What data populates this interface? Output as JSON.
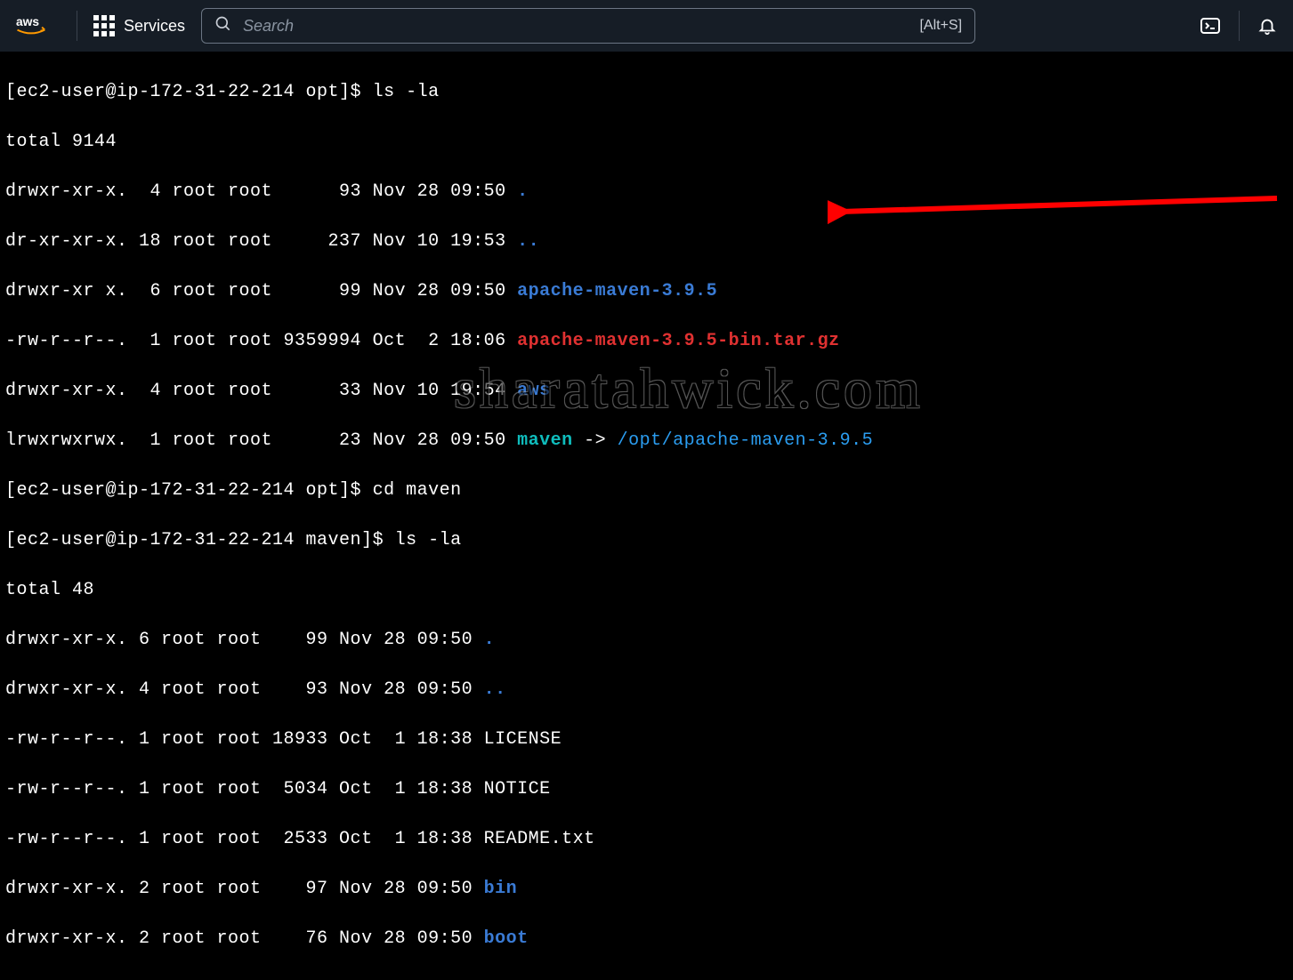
{
  "header": {
    "services_label": "Services",
    "search_placeholder": "Search",
    "search_hint": "[Alt+S]"
  },
  "watermark": "sharatahwick.com",
  "prompts": {
    "p1": "[ec2-user@ip-172-31-22-214 opt]$ ",
    "p2": "[ec2-user@ip-172-31-22-214 opt]$ ",
    "p3": "[ec2-user@ip-172-31-22-214 maven]$ "
  },
  "cmds": {
    "c1": "ls -la",
    "c2": "cd maven",
    "c3": "ls -la"
  },
  "ls1": {
    "total": "total 9144",
    "r1": "drwxr-xr-x.  4 root root      93 Nov 28 09:50 ",
    "r1n": ".",
    "r2": "dr-xr-xr-x. 18 root root     237 Nov 10 19:53 ",
    "r2n": "..",
    "r3": "drwxr-xr x.  6 root root      99 Nov 28 09:50 ",
    "r3n": "apache-maven-3.9.5",
    "r4": "-rw-r--r--.  1 root root 9359994 Oct  2 18:06 ",
    "r4n": "apache-maven-3.9.5-bin.tar.gz",
    "r5": "drwxr-xr-x.  4 root root      33 Nov 10 19:54 ",
    "r5n": "aws",
    "r6": "lrwxrwxrwx.  1 root root      23 Nov 28 09:50 ",
    "r6n": "maven",
    "r6a": " -> ",
    "r6t": "/opt/apache-maven-3.9.5"
  },
  "ls2": {
    "total": "total 48",
    "r1": "drwxr-xr-x. 6 root root    99 Nov 28 09:50 ",
    "r1n": ".",
    "r2": "drwxr-xr-x. 4 root root    93 Nov 28 09:50 ",
    "r2n": "..",
    "r3": "-rw-r--r--. 1 root root 18933 Oct  1 18:38 LICENSE",
    "r4": "-rw-r--r--. 1 root root  5034 Oct  1 18:38 NOTICE",
    "r5": "-rw-r--r--. 1 root root  2533 Oct  1 18:38 README.txt",
    "r6": "drwxr-xr-x. 2 root root    97 Nov 28 09:50 ",
    "r6n": "bin",
    "r7": "drwxr-xr-x. 2 root root    76 Nov 28 09:50 ",
    "r7n": "boot"
  }
}
